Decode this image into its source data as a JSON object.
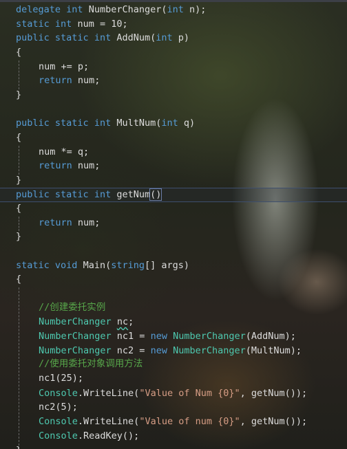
{
  "code": {
    "l01": {
      "kw1": "delegate",
      "kw2": "int",
      "name": "NumberChanger(",
      "kw3": "int",
      "rest": " n);"
    },
    "l02": {
      "kw1": "static",
      "kw2": "int",
      "rest": " num = 10;"
    },
    "l03": {
      "kw1": "public",
      "kw2": "static",
      "kw3": "int",
      "name": " AddNum(",
      "kw4": "int",
      "rest": " p)"
    },
    "l04": {
      "text": "{"
    },
    "l05": {
      "text": "num += p;"
    },
    "l06": {
      "kw": "return",
      "rest": " num;"
    },
    "l07": {
      "text": "}"
    },
    "l09": {
      "kw1": "public",
      "kw2": "static",
      "kw3": "int",
      "name": " MultNum(",
      "kw4": "int",
      "rest": " q)"
    },
    "l10": {
      "text": "{"
    },
    "l11": {
      "text": "num *= q;"
    },
    "l12": {
      "kw": "return",
      "rest": " num;"
    },
    "l13": {
      "text": "}"
    },
    "l14": {
      "kw1": "public",
      "kw2": "static",
      "kw3": "int",
      "name": " getNum",
      "parens": "()"
    },
    "l15": {
      "text": "{"
    },
    "l16": {
      "kw": "return",
      "rest": " num;"
    },
    "l17": {
      "text": "}"
    },
    "l19": {
      "kw1": "static",
      "kw2": "void",
      "name": " Main(",
      "kw3": "string",
      "rest": "[] args)"
    },
    "l20": {
      "text": "{"
    },
    "l22": {
      "comment": "//创建委托实例"
    },
    "l23": {
      "type": "NumberChanger",
      "var": "nc",
      "rest": ";"
    },
    "l24": {
      "type1": "NumberChanger",
      "mid": " nc1 = ",
      "kw": "new",
      "type2": "NumberChanger",
      "rest": "(AddNum);"
    },
    "l25": {
      "type1": "NumberChanger",
      "mid": " nc2 = ",
      "kw": "new",
      "type2": "NumberChanger",
      "rest": "(MultNum);"
    },
    "l26": {
      "comment": "//使用委托对象调用方法"
    },
    "l27": {
      "text": "nc1(25);"
    },
    "l28": {
      "type": "Console",
      "call": ".WriteLine(",
      "str": "\"Value of Num {0}\"",
      "rest": ", getNum());"
    },
    "l29": {
      "text": "nc2(5);"
    },
    "l30": {
      "type": "Console",
      "call": ".WriteLine(",
      "str": "\"Value of num {0}\"",
      "rest": ", getNum());"
    },
    "l31": {
      "type": "Console",
      "rest": ".ReadKey();"
    },
    "l32": {
      "text": "}"
    }
  },
  "colors": {
    "keyword": "#569cd6",
    "type": "#4ec9b0",
    "comment": "#57a64a",
    "string": "#d69d85",
    "text": "#dcdcdc"
  }
}
